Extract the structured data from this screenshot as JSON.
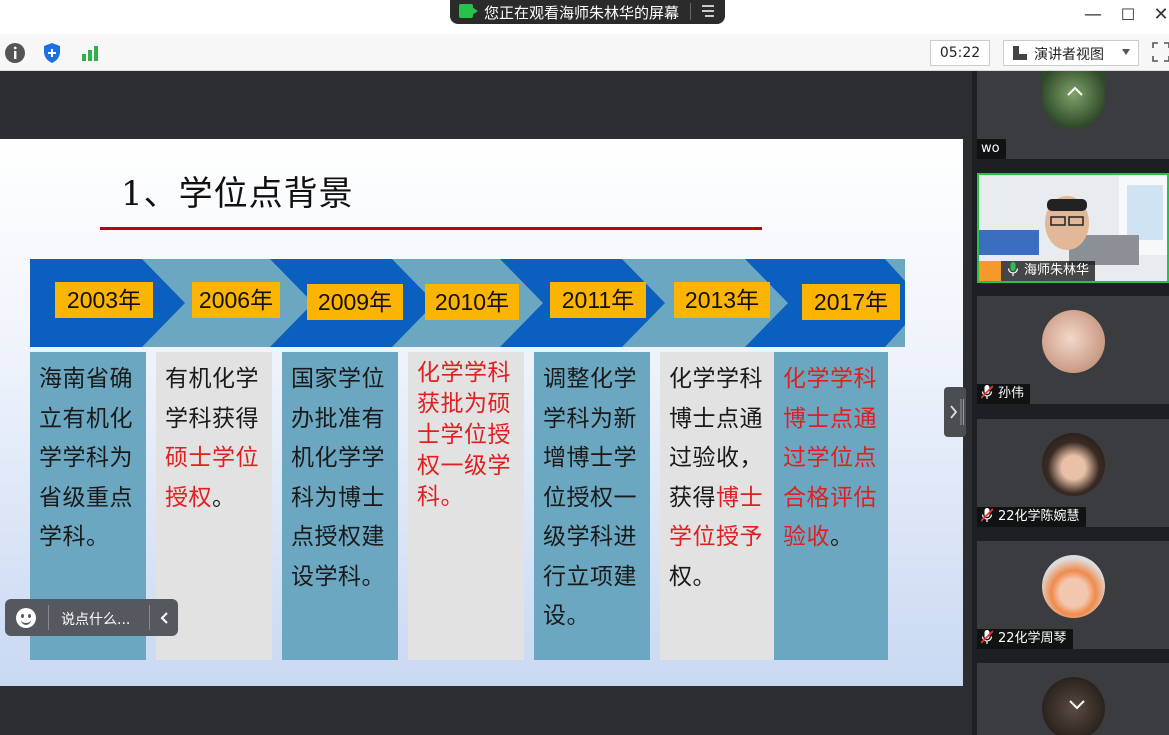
{
  "window": {
    "share_banner": "您正在观看海师朱林华的屏幕",
    "minimize": "—",
    "maximize": "☐",
    "close": "✕"
  },
  "toolbar": {
    "timer": "05:22",
    "view_mode": "演讲者视图"
  },
  "slide": {
    "title": "1、学位点背景",
    "years": [
      "2003年",
      "2006年",
      "2009年",
      "2010年",
      "2011年",
      "2013年",
      "2017年"
    ],
    "columns": [
      {
        "parts": [
          {
            "t": "海南省确立有机化学学科为省级重点学科。",
            "red": false
          }
        ]
      },
      {
        "parts": [
          {
            "t": "有机化学学科获得",
            "red": false
          },
          {
            "t": "硕士学位授权",
            "red": true
          },
          {
            "t": "。",
            "red": false
          }
        ]
      },
      {
        "parts": [
          {
            "t": "国家学位办批准有机化学学科为博士点授权建设学科。",
            "red": false
          }
        ]
      },
      {
        "parts": [
          {
            "t": "化学学科获批为硕士学位授权一级学科。",
            "red": true
          }
        ]
      },
      {
        "parts": [
          {
            "t": "调整化学学科为新增博士学位授权一级学科进行立项建设。",
            "red": false
          }
        ]
      },
      {
        "parts": [
          {
            "t": "化学学科博士点通过验收，获得",
            "red": false
          },
          {
            "t": "博士学位授予",
            "red": true
          },
          {
            "t": "权。",
            "red": false
          }
        ]
      },
      {
        "parts": [
          {
            "t": "化学学科博士点通过学位点合格评估验收",
            "red": true
          },
          {
            "t": "。",
            "red": false
          }
        ]
      }
    ]
  },
  "chat": {
    "placeholder": "说点什么..."
  },
  "participants": [
    {
      "name": "wo",
      "muted": false,
      "kind": "avatar"
    },
    {
      "name": "海师朱林华",
      "muted": false,
      "kind": "video",
      "speaking": true
    },
    {
      "name": "孙伟",
      "muted": true,
      "kind": "avatar"
    },
    {
      "name": "22化学陈婉慧",
      "muted": true,
      "kind": "avatar"
    },
    {
      "name": "22化学周琴",
      "muted": true,
      "kind": "avatar"
    },
    {
      "name": "",
      "muted": false,
      "kind": "avatar"
    }
  ],
  "colors": {
    "accent_red": "#c00000",
    "highlight_red": "#e02020",
    "year_box": "#fbb500",
    "arrow_dark": "#0a5fbf",
    "arrow_light": "#6ba7c0",
    "col_blue": "#6ba7c0",
    "col_grey": "#e2e2e2",
    "speaking_border": "#27c24c"
  }
}
